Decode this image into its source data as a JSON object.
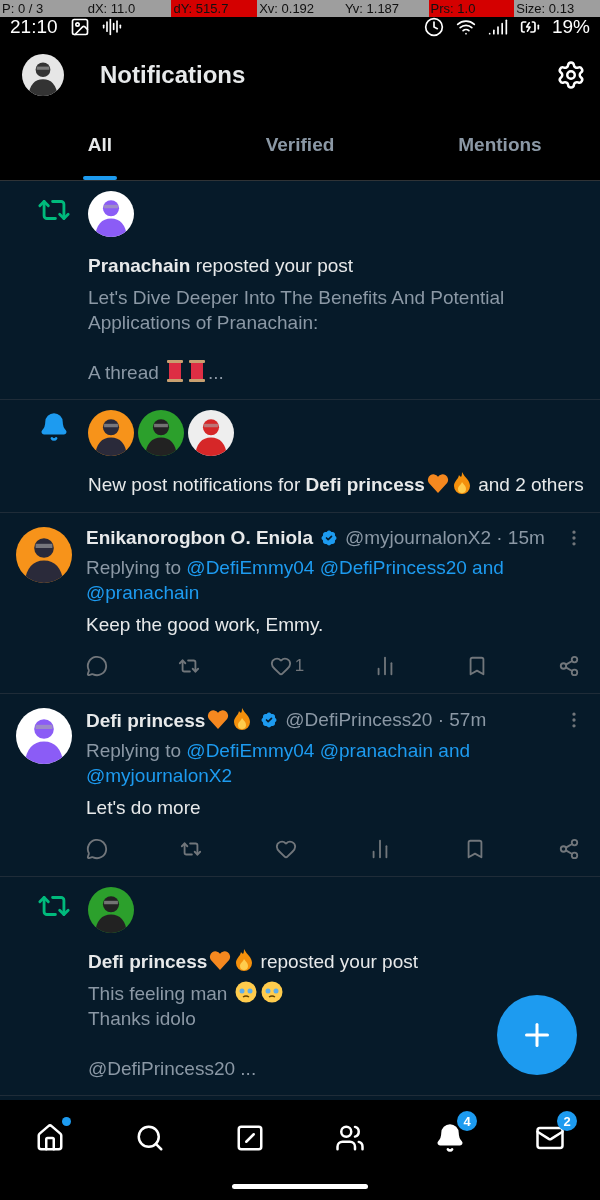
{
  "debug_overlay": [
    {
      "text": "P: 0 / 3",
      "color": "#9e9e9e"
    },
    {
      "text": "dX: 11.0",
      "color": "#9e9e9e"
    },
    {
      "text": "dY: 515.7",
      "color": "#d40000"
    },
    {
      "text": "Xv: 0.192",
      "color": "#9e9e9e"
    },
    {
      "text": "Yv: 1.187",
      "color": "#9e9e9e"
    },
    {
      "text": "Prs: 1.0",
      "color": "#d40000"
    },
    {
      "text": "Size: 0.13",
      "color": "#9e9e9e"
    }
  ],
  "status_bar": {
    "time": "21:10",
    "battery": "19%"
  },
  "header": {
    "title": "Notifications"
  },
  "tabs": [
    {
      "label": "All",
      "selected": true
    },
    {
      "label": "Verified",
      "selected": false
    },
    {
      "label": "Mentions",
      "selected": false
    }
  ],
  "notifications": [
    {
      "kind": "repost",
      "avatars": [
        {
          "kind": "picture"
        }
      ],
      "message": [
        {
          "kind": "bold",
          "text": "Pranachain"
        },
        {
          "kind": "text",
          "text": " reposted your post"
        }
      ],
      "preview": [
        {
          "kind": "text",
          "text": "Let's Dive Deeper Into The Benefits And Potential Applications of Pranachain:"
        },
        {
          "kind": "break"
        },
        {
          "kind": "text",
          "text": "A thread "
        },
        {
          "kind": "spool"
        },
        {
          "kind": "spool"
        },
        {
          "kind": "text",
          "text": "..."
        }
      ]
    },
    {
      "kind": "alert",
      "avatars": [
        {
          "kind": "picture"
        },
        {
          "kind": "picture"
        },
        {
          "kind": "picture"
        }
      ],
      "message": [
        {
          "kind": "text",
          "text": "New post notifications for "
        },
        {
          "kind": "bold",
          "text": "Defi princess"
        },
        {
          "kind": "heart"
        },
        {
          "kind": "fire"
        },
        {
          "kind": "text",
          "text": " and 2 others"
        }
      ]
    },
    {
      "kind": "reply",
      "author": [
        {
          "kind": "bold",
          "text": "Enikanorogbon O. Eniola"
        }
      ],
      "verified": true,
      "handle": "@myjournalonX2 · 15m",
      "replying": [
        {
          "kind": "text",
          "text": "Replying to "
        },
        {
          "kind": "link",
          "text": "@DefiEmmy04"
        },
        {
          "kind": "link",
          "text": "@DefiPrincess20"
        },
        {
          "kind": "link",
          "text": "and"
        },
        {
          "kind": "link",
          "text": "@pranachain"
        }
      ],
      "body": "Keep the good work, Emmy.",
      "actions": [
        {
          "kind": "reply"
        },
        {
          "kind": "repost"
        },
        {
          "kind": "like",
          "count": "1"
        },
        {
          "kind": "views"
        },
        {
          "kind": "bookmark"
        },
        {
          "kind": "share"
        }
      ]
    },
    {
      "kind": "reply",
      "author": [
        {
          "kind": "bold",
          "text": "Defi princess"
        },
        {
          "kind": "heart"
        },
        {
          "kind": "fire"
        }
      ],
      "verified": true,
      "handle": "@DefiPrincess20 · 57m",
      "replying": [
        {
          "kind": "text",
          "text": "Replying to "
        },
        {
          "kind": "link",
          "text": "@DefiEmmy04"
        },
        {
          "kind": "link",
          "text": "@pranachain"
        },
        {
          "kind": "link",
          "text": "and"
        },
        {
          "kind": "link",
          "text": "@myjournalonX2"
        }
      ],
      "body": "Let's do more",
      "actions": [
        {
          "kind": "reply"
        },
        {
          "kind": "repost"
        },
        {
          "kind": "like"
        },
        {
          "kind": "views"
        },
        {
          "kind": "bookmark"
        },
        {
          "kind": "share"
        }
      ]
    },
    {
      "kind": "repost",
      "avatars": [
        {
          "kind": "picture"
        }
      ],
      "message": [
        {
          "kind": "bold",
          "text": "Defi princess"
        },
        {
          "kind": "heart"
        },
        {
          "kind": "fire"
        },
        {
          "kind": "text",
          "text": " reposted your post"
        }
      ],
      "preview": [
        {
          "kind": "text",
          "text": "This feeling man "
        },
        {
          "kind": "tearface"
        },
        {
          "kind": "tearface"
        },
        {
          "kind": "newline"
        },
        {
          "kind": "text",
          "text": "Thanks idolo"
        },
        {
          "kind": "break"
        },
        {
          "kind": "text",
          "text": "@DefiPrincess20 ..."
        }
      ]
    }
  ],
  "bottom_nav": [
    {
      "kind": "home",
      "dot": true
    },
    {
      "kind": "search"
    },
    {
      "kind": "compose"
    },
    {
      "kind": "communities"
    },
    {
      "kind": "notifications",
      "badge": "4"
    },
    {
      "kind": "messages",
      "badge": "2"
    }
  ]
}
